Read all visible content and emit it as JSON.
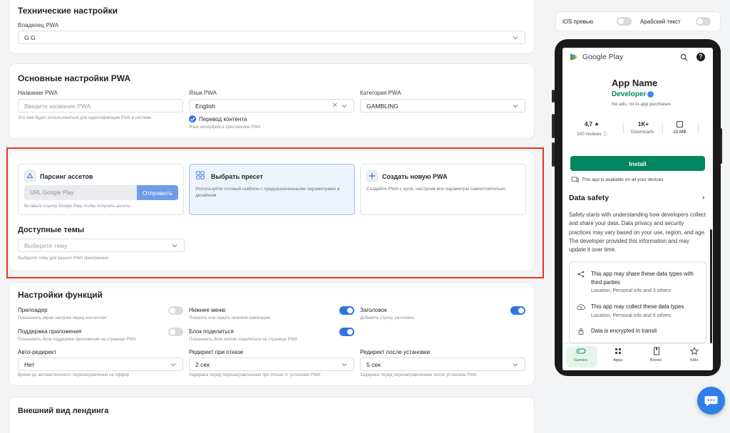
{
  "tech": {
    "title": "Технические настройки",
    "owner_label": "Владелец PWA",
    "owner_value": "G G"
  },
  "basic": {
    "title": "Основные настройки PWA",
    "name_label": "Название PWA",
    "name_placeholder": "Введите название PWA",
    "name_hint": "Это имя будет использоваться для идентификации PWA в системе",
    "lang_label": "Язык PWA",
    "lang_value": "English",
    "translate_label": "Перевод контента",
    "translate_hint": "Язык интерфейса приложения PWA",
    "category_label": "Категория PWA",
    "category_value": "GAMBLING"
  },
  "source": {
    "parse_title": "Парсинг ассетов",
    "url_placeholder": "URL Google Play",
    "send_label": "Отправить",
    "parse_hint": "Вставьте ссылку Google Play, чтобы получить ассеты",
    "preset_title": "Выбрать пресет",
    "preset_desc": "Используйте готовый шаблон с предназначенными параметрами и дизайном",
    "new_title": "Создать новую PWA",
    "new_desc": "Создайте PWA с нуля, настроив все параметры самостоятельно",
    "themes_title": "Доступные темы",
    "theme_placeholder": "Выберите тему",
    "theme_hint": "Выберите тему для вашего PWA приложения"
  },
  "features": {
    "title": "Настройки функций",
    "preloader": "Прелоадер",
    "preloader_hint": "Показывать экран загрузки перед контентом",
    "bottom_menu": "Нижнее меню",
    "bottom_menu_hint": "Показать или скрыть нижнюю навигацию",
    "header": "Заголовок",
    "header_hint": "Добавить строку заголовка",
    "support": "Поддержка приложения",
    "support_hint": "Показывать блок поддержки приложения на странице PWA",
    "share": "Блок поделиться",
    "share_hint": "Показывать блок кнопки поделиться на странице PWA",
    "auto_redirect": "Авто-редирект",
    "auto_redirect_value": "Нет",
    "auto_redirect_hint": "Время до автоматического перенаправления на оффер",
    "fail_redirect": "Редирект при отказе",
    "fail_redirect_value": "2 сек",
    "fail_redirect_hint": "Задержка перед перенаправлением при отказе от установки PWA",
    "install_redirect": "Редирект после установки",
    "install_redirect_value": "5 сек",
    "install_redirect_hint": "Задержка перед перенаправлением после установки PWA"
  },
  "landing": {
    "title": "Внешний вид лендинга"
  },
  "preview": {
    "ios_label": "iOS превью",
    "arabic_label": "Арабский текст"
  },
  "phone": {
    "store": "Google Play",
    "app_name": "App Name",
    "developer": "Developer",
    "ads": "No ads, no in-app purchases",
    "rating": "4,7 ★",
    "reviews": "100 reviews ⓘ",
    "downloads": "1K+",
    "downloads_label": "Downloads",
    "size": "15 MB",
    "install": "Install",
    "available": "This app is available on all your devices",
    "safety_title": "Data safety",
    "safety_text": "Safety starts with understanding how developers collect and share your data. Data privacy and security practices may vary based on your use, region, and age. The developer provided this information and may update it over time.",
    "share_title": "This app may share these data types with third parties",
    "share_sub": "Location, Personal info and 3 others",
    "collect_title": "This app may collect these data types",
    "collect_sub": "Location, Personal info and 6 others",
    "encrypted": "Data is encrypted in transit",
    "nav": [
      "Games",
      "Apps",
      "Books",
      "Kids"
    ]
  },
  "colors": {
    "accent": "#2f73e0",
    "install_green": "#01875f",
    "highlight_red": "#e8351f"
  }
}
